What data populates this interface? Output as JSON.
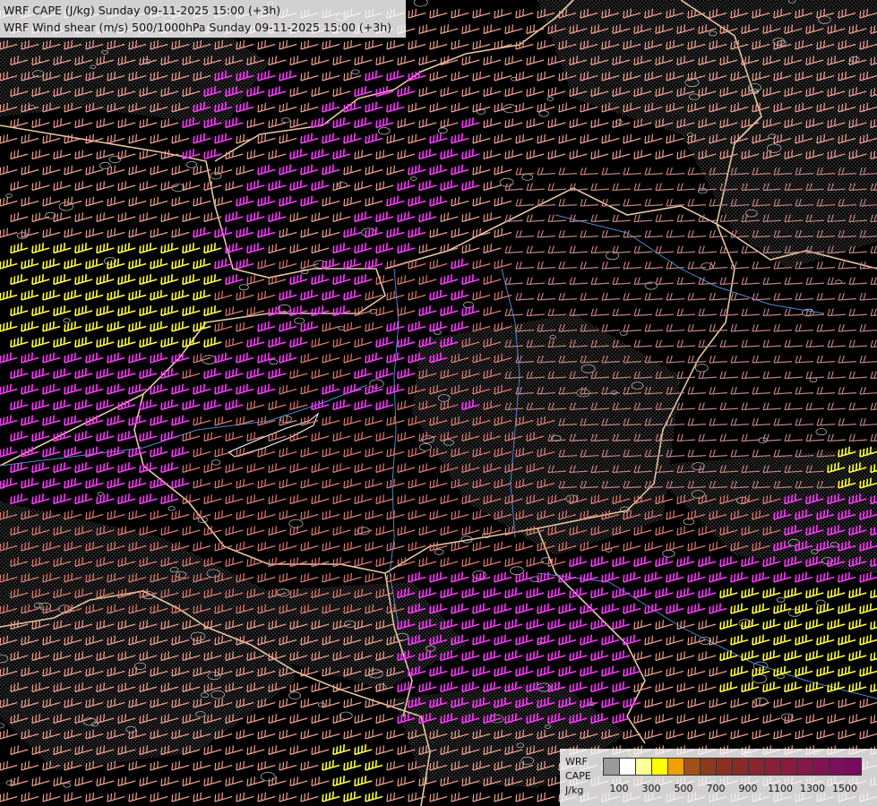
{
  "titles": {
    "line1": "WRF CAPE (J/kg) Sunday 09-11-2025 15:00 (+3h)",
    "line2": "WRF Wind shear (m/s) 500/1000hPa Sunday 09-11-2025 15:00 (+3h)"
  },
  "legend": {
    "label_top": "WRF",
    "label_mid": "CAPE",
    "label_unit": "J/kg",
    "ticks": [
      "100",
      "300",
      "500",
      "700",
      "900",
      "1100",
      "1300",
      "1500"
    ],
    "swatch_colors": [
      "#9a9a9a",
      "#ffffff",
      "#ffff99",
      "#ffff00",
      "#f0a000",
      "#a05018",
      "#8a3a1e",
      "#8a3020",
      "#8a2a28",
      "#8a2530",
      "#8a2038",
      "#8a1a40",
      "#851848",
      "#801450",
      "#7a1058",
      "#780a60"
    ]
  },
  "colors": {
    "barb_low": "#e07a70",
    "barb_mid": "#f0a090",
    "barb_high": "#ff33ff",
    "barb_max": "#ffff33",
    "barb_calm": "#c08080",
    "border": "#e6c9a0",
    "river": "#4a8ad0",
    "contour": "#b0b0b0"
  }
}
